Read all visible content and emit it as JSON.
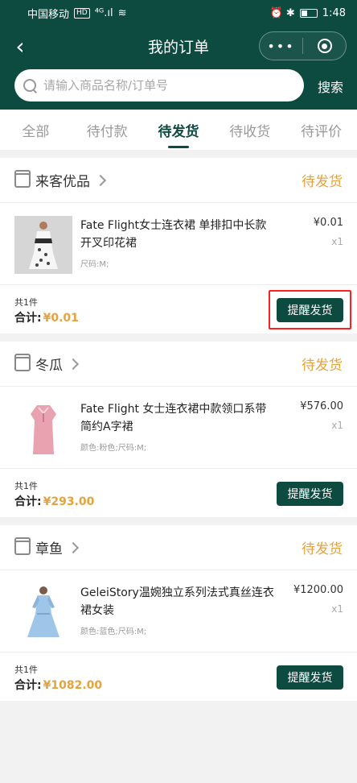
{
  "status_bar": {
    "carrier": "中国移动",
    "hd": "HD",
    "signal": "⁴ᴳ.ıl",
    "wifi": "≋",
    "icons": "⏰ ✱",
    "time": "1:48"
  },
  "header": {
    "title": "我的订单",
    "back_icon": "chevron-left-icon",
    "more_icon": "more-icon",
    "target_icon": "target-icon"
  },
  "search": {
    "placeholder": "请输入商品名称/订单号",
    "button": "搜索"
  },
  "tabs": [
    {
      "label": "全部",
      "active": false
    },
    {
      "label": "待付款",
      "active": false
    },
    {
      "label": "待发货",
      "active": true
    },
    {
      "label": "待收货",
      "active": false
    },
    {
      "label": "待评价",
      "active": false
    }
  ],
  "orders": [
    {
      "shop": "来客优品",
      "status": "待发货",
      "item": {
        "name": "Fate Flight女士连衣裙 单排扣中长款开叉印花裙",
        "spec": "尺码:M;",
        "price": "¥0.01",
        "qty": "x1"
      },
      "count": "共1件",
      "total_label": "合计:",
      "total": "¥0.01",
      "action": "提醒发货",
      "highlighted": true
    },
    {
      "shop": "冬瓜",
      "status": "待发货",
      "item": {
        "name": "Fate Flight 女士连衣裙中款领口系带简约A字裙",
        "spec": "颜色:粉色;尺码:M;",
        "price": "¥576.00",
        "qty": "x1"
      },
      "count": "共1件",
      "total_label": "合计:",
      "total": "¥293.00",
      "action": "提醒发货",
      "highlighted": false
    },
    {
      "shop": "章鱼",
      "status": "待发货",
      "item": {
        "name": "GeleiStory温婉独立系列法式真丝连衣裙女装",
        "spec": "颜色:蓝色;尺码:M;",
        "price": "¥1200.00",
        "qty": "x1"
      },
      "count": "共1件",
      "total_label": "合计:",
      "total": "¥1082.00",
      "action": "提醒发货",
      "highlighted": false
    }
  ],
  "colors": {
    "primary": "#0d4a3f",
    "accent": "#e6a23c",
    "highlight": "#ff1f1f"
  }
}
